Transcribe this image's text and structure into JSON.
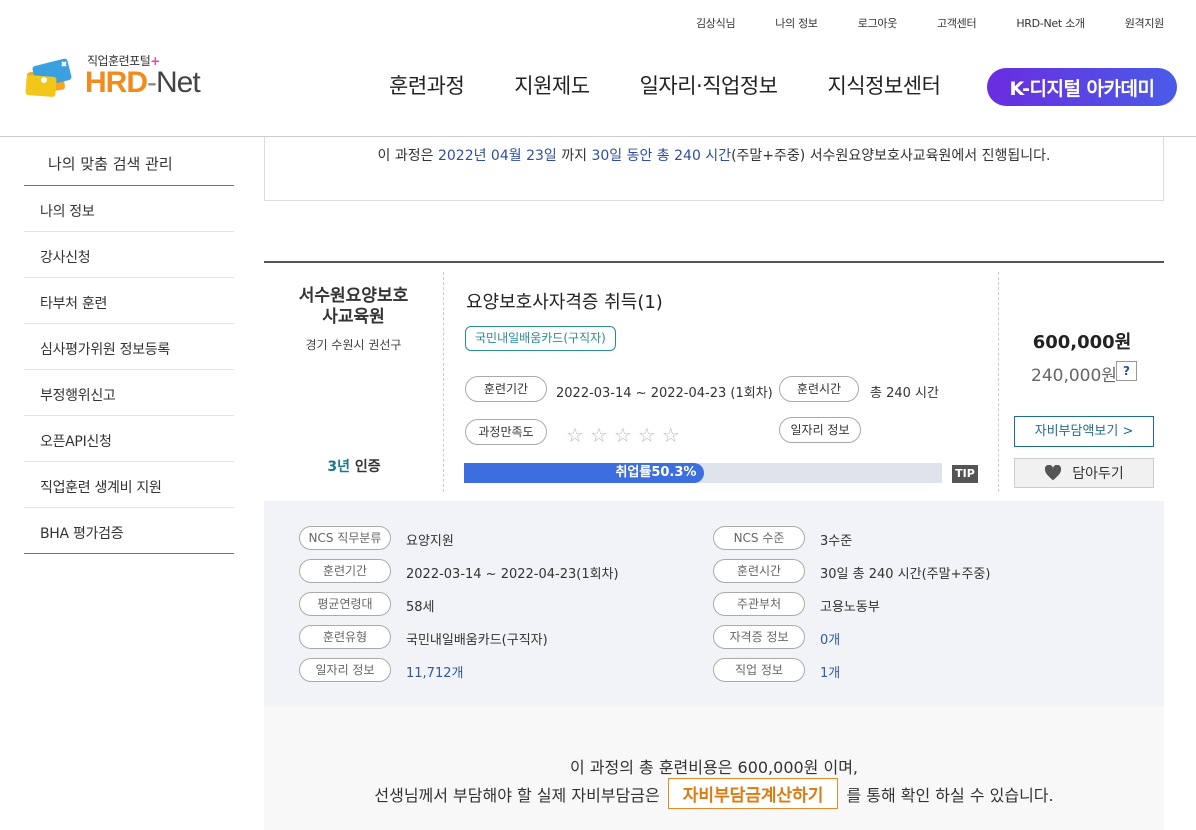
{
  "utility_nav": [
    "김상식님",
    "나의 정보",
    "로그아웃",
    "고객센터",
    "HRD-Net 소개",
    "원격지원"
  ],
  "logo": {
    "sub": "직업훈련포털",
    "sub_plus": "+",
    "hrd": "HRD",
    "dash": "-",
    "net": "Net"
  },
  "main_nav": [
    "훈련과정",
    "지원제도",
    "일자리·직업정보",
    "지식정보센터"
  ],
  "main_nav_highlight": "K-디지털 아카데미",
  "sidebar": {
    "top": "나의 맞춤 검색 관리",
    "items": [
      "나의 정보",
      "강사신청",
      "타부처 훈련",
      "심사평가위원 정보등록",
      "부정행위신고",
      "오픈API신청",
      "직업훈련 생계비 지원",
      "BHA 평가검증"
    ]
  },
  "info": {
    "prefix": "이 과정은 ",
    "end_date": "2022년 04월 23일",
    "mid1": " 까지 ",
    "duration": "30일 동안 총 240 시간",
    "suffix": "(주말+주중) 서수원요양보호사교육원에서 진행됩니다."
  },
  "course": {
    "institution": "서수원요양보호사교육원",
    "location": "경기 수원시 권선구",
    "cert_years": "3년",
    "cert_label": "인증",
    "title": "요양보호사자격증 취득(1)",
    "tag": "국민내일배움카드(구직자)",
    "period_label": "훈련기간",
    "period_value": "2022-03-14 ~ 2022-04-23 (1회차)",
    "hours_label": "훈련시간",
    "hours_value": "총 240 시간",
    "satisfaction_label": "과정만족도",
    "rating": 0,
    "rating_max": 5,
    "job_info_label": "일자리 정보",
    "employment_text": "취업률50.3%",
    "employment_rate": 0.503,
    "tip": "TIP",
    "price": "600,000원",
    "self_pay": "240,000원",
    "help": "?",
    "calc_button": "자비부담액보기 >",
    "like_button": "담아두기"
  },
  "details": {
    "left": [
      {
        "label": "NCS 직무분류",
        "value": "요양지원"
      },
      {
        "label": "훈련기간",
        "value": "2022-03-14 ~ 2022-04-23(1회차)"
      },
      {
        "label": "평균연령대",
        "value": "58세"
      },
      {
        "label": "훈련유형",
        "value": "국민내일배움카드(구직자)"
      },
      {
        "label": "일자리 정보",
        "value": "11,712개"
      }
    ],
    "right": [
      {
        "label": "NCS 수준",
        "value": "3수준"
      },
      {
        "label": "훈련시간",
        "value": "30일 총 240 시간(주말+주중)"
      },
      {
        "label": "주관부처",
        "value": "고용노동부"
      },
      {
        "label": "자격증 정보",
        "value": "0개"
      },
      {
        "label": "직업 정보",
        "value": "1개"
      }
    ]
  },
  "cost_note": {
    "line1": "이 과정의 총 훈련비용은 600,000원 이며,",
    "line2_pre": "선생님께서 부담해야 할 실제 자비부담금은",
    "calc_label": "자비부담금계산하기",
    "line2_post": "를 통해 확인 하실 수 있습니다."
  },
  "colors": {
    "accent_blue": "#2f4ea3",
    "teal": "#2a8d95",
    "orange": "#e07a10",
    "bar_fill": "#3d6ee0",
    "kdigital": "#5a45e4"
  }
}
